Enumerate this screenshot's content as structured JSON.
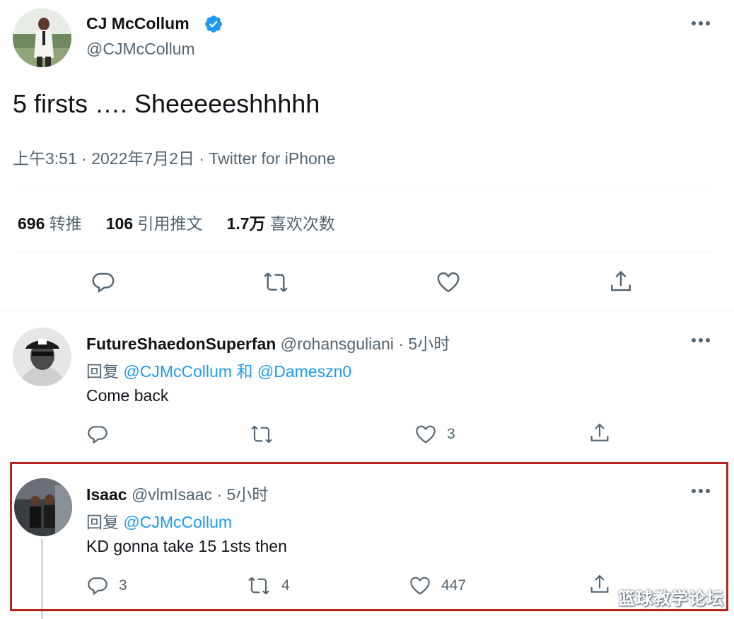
{
  "main_tweet": {
    "author_name": "CJ McCollum",
    "author_handle": "@CJMcCollum",
    "text": "5 firsts …. Sheeeeeshhhhh",
    "meta": "上午3:51 · 2022年7月2日 · Twitter for iPhone",
    "stats": {
      "retweets_count": "696",
      "retweets_label": "转推",
      "quotes_count": "106",
      "quotes_label": "引用推文",
      "likes_count": "1.7万",
      "likes_label": "喜欢次数"
    },
    "icons": [
      "reply-icon",
      "retweet-icon",
      "like-icon",
      "share-icon"
    ]
  },
  "replies": [
    {
      "author_name": "FutureShaedonSuperfan",
      "author_handle": "@rohansguliani",
      "time": "· 5小时",
      "reply_prefix": "回复",
      "mention_1": "@CJMcCollum",
      "conjunction": "和",
      "mention_2": "@Dameszn0",
      "text": "Come back",
      "reply_count": "",
      "retweet_count": "",
      "like_count": "3"
    },
    {
      "author_name": "Isaac",
      "author_handle": "@vlmIsaac",
      "time": "· 5小时",
      "reply_prefix": "回复",
      "mention_1": "@CJMcCollum",
      "text": "KD gonna take 15 1sts then",
      "reply_count": "3",
      "retweet_count": "4",
      "like_count": "447"
    }
  ],
  "watermark": "篮球教学论坛",
  "colors": {
    "link": "#1d9bf0",
    "verified": "#1d9bf0",
    "muted": "#536471",
    "highlight_border": "#b5251c"
  }
}
